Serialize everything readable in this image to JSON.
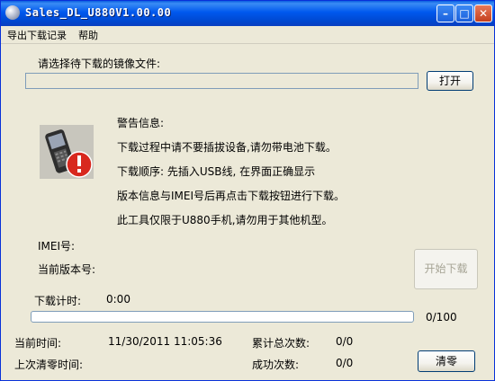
{
  "window": {
    "title": "Sales_DL_U880V1.00.00"
  },
  "menu": {
    "export_log": "导出下载记录",
    "help": "帮助"
  },
  "file": {
    "prompt": "请选择待下载的镜像文件:",
    "path": "",
    "open_button": "打开"
  },
  "warning": {
    "heading": "警告信息:",
    "line1": "下载过程中请不要插拔设备,请勿带电池下载。",
    "line2": "下载顺序: 先插入USB线, 在界面正确显示",
    "line3": "版本信息与IMEI号后再点击下载按钮进行下载。",
    "line4": "此工具仅限于U880手机,请勿用于其他机型。"
  },
  "device": {
    "imei_label": "IMEI号:",
    "version_label": "当前版本号:",
    "start_button": "开始下载"
  },
  "timer": {
    "label": "下载计时:",
    "value": "0:00"
  },
  "progress": {
    "value": 0,
    "count_text": "0/100"
  },
  "status": {
    "current_time_label": "当前时间:",
    "current_time": "11/30/2011 11:05:36",
    "total_label": "累计总次数:",
    "total_value": "0/0",
    "last_reset_label": "上次清零时间:",
    "success_label": "成功次数:",
    "success_value": "0/0",
    "reset_button": "清零"
  },
  "icons": [
    "app-icon",
    "minimize-icon",
    "maximize-icon",
    "close-icon",
    "phone-warning-icon"
  ]
}
